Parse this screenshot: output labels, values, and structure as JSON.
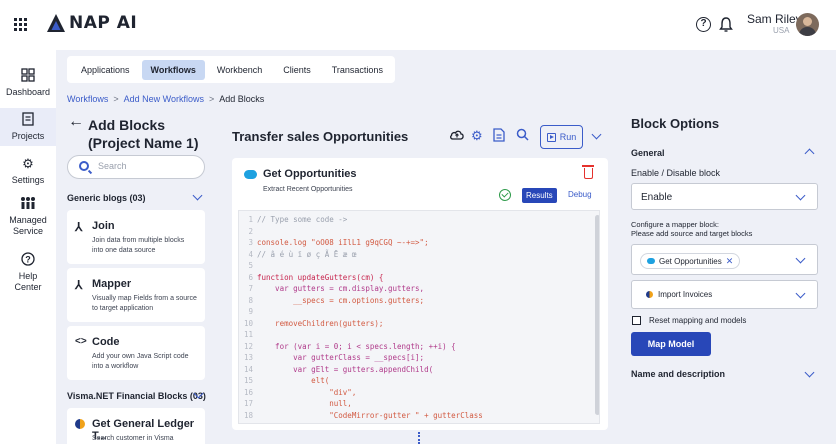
{
  "header": {
    "brand": "NAP AI",
    "help_icon": "help-circle-icon",
    "notifications_icon": "bell-icon",
    "user_name": "Sam Riley",
    "user_country": "USA"
  },
  "leftnav": {
    "items": [
      {
        "label": "Dashboard",
        "icon": "dashboard-icon"
      },
      {
        "label": "Projects",
        "icon": "projects-icon"
      },
      {
        "label": "Settings",
        "icon": "gear-icon"
      },
      {
        "label": "Managed Service",
        "icon": "managed-service-icon"
      },
      {
        "label": "Help Center",
        "icon": "help-icon"
      }
    ],
    "active": "Projects"
  },
  "tabs": [
    "Applications",
    "Workflows",
    "Workbench",
    "Clients",
    "Transactions"
  ],
  "active_tab": "Workflows",
  "breadcrumb": [
    "Workflows",
    "Add New Workflows",
    "Add Blocks"
  ],
  "add_blocks": {
    "title": "Add Blocks (Project Name 1)",
    "search_placeholder": "Search",
    "generic_section": "Generic blogs (03)",
    "cards": [
      {
        "icon": "join-icon",
        "title": "Join",
        "desc": "Join data from multiple blocks into one data source"
      },
      {
        "icon": "mapper-icon",
        "title": "Mapper",
        "desc": "Visually map Fields from a source to target application"
      },
      {
        "icon": "code-icon",
        "title": "Code",
        "desc": "Add your own Java Script code into a workflow"
      }
    ],
    "visma_section": "Visma.NET Financial Blocks (03)",
    "visma_card": {
      "title": "Get General Ledger T...",
      "desc": "Search customer in Visma"
    }
  },
  "workflow": {
    "title": "Transfer sales Opportunities",
    "run_label": "Run",
    "block": {
      "title": "Get Opportunities",
      "subtitle": "Extract Recent Opportunities",
      "results_label": "Results",
      "debug_label": "Debug"
    },
    "code_lines": [
      {
        "n": "1",
        "t": "// Type some code ->"
      },
      {
        "n": "2",
        "t": ""
      },
      {
        "n": "3",
        "t": "console.log \"oO08 iIlL1 g9qCGQ ~-+=>\";"
      },
      {
        "n": "4",
        "t": "// â é ù ï ø ç Ã Ē æ œ"
      },
      {
        "n": "5",
        "t": ""
      },
      {
        "n": "6",
        "t": "function updateGutters(cm) {"
      },
      {
        "n": "7",
        "t": "    var gutters = cm.display.gutters,"
      },
      {
        "n": "8",
        "t": "        __specs = cm.options.gutters;"
      },
      {
        "n": "9",
        "t": ""
      },
      {
        "n": "10",
        "t": "    removeChildren(gutters);"
      },
      {
        "n": "11",
        "t": ""
      },
      {
        "n": "12",
        "t": "    for (var i = 0; i < specs.length; ++i) {"
      },
      {
        "n": "13",
        "t": "        var gutterClass = __specs[i];"
      },
      {
        "n": "14",
        "t": "        var gElt = gutters.appendChild("
      },
      {
        "n": "15",
        "t": "            elt("
      },
      {
        "n": "16",
        "t": "                \"div\","
      },
      {
        "n": "17",
        "t": "                null,"
      },
      {
        "n": "18",
        "t": "                \"CodeMirror-gutter \" + gutterClass"
      }
    ]
  },
  "block_options": {
    "title": "Block Options",
    "general_label": "General",
    "enable_label": "Enable / Disable block",
    "enable_value": "Enable",
    "mapper_note_1": "Configure a mapper block:",
    "mapper_note_2": "Please add source and target blocks",
    "source_chip": "Get Opportunities",
    "target_chip": "Import Invoices",
    "reset_label": "Reset mapping and models",
    "map_button": "Map Model",
    "name_section": "Name and description"
  },
  "colors": {
    "accent": "#3b5cc9",
    "primary_button": "#2847b8",
    "active_tab": "#c8d8f3",
    "background": "#eef0f7",
    "danger": "#e5322d",
    "success": "#2e9a4a"
  }
}
